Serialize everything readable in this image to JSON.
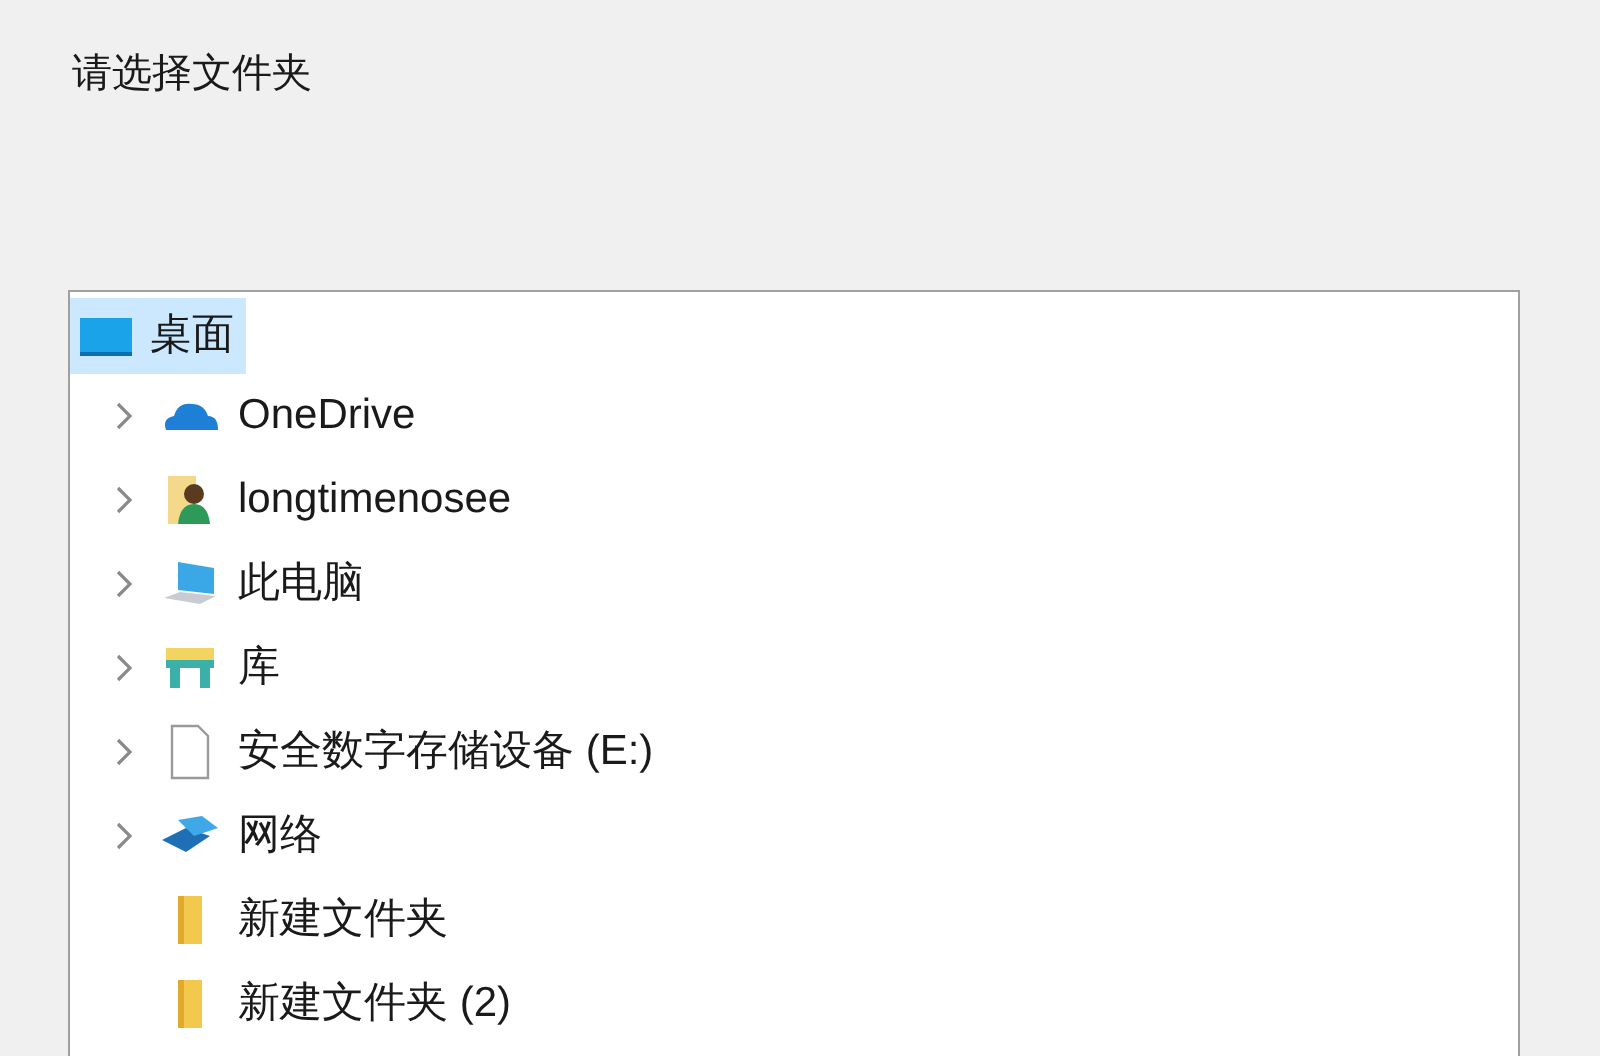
{
  "prompt": "请选择文件夹",
  "tree": {
    "label": "桌面",
    "kind": "desktop",
    "selected": true,
    "children": [
      {
        "label": "OneDrive",
        "kind": "cloud",
        "expandable": true,
        "selected": false
      },
      {
        "label": "longtimenosee",
        "kind": "user",
        "expandable": true,
        "selected": false
      },
      {
        "label": "此电脑",
        "kind": "computer",
        "expandable": true,
        "selected": false
      },
      {
        "label": "库",
        "kind": "library",
        "expandable": true,
        "selected": false
      },
      {
        "label": "安全数字存储设备 (E:)",
        "kind": "drive",
        "expandable": true,
        "selected": false
      },
      {
        "label": "网络",
        "kind": "network",
        "expandable": true,
        "selected": false
      },
      {
        "label": "新建文件夹",
        "kind": "folder",
        "expandable": false,
        "selected": false
      },
      {
        "label": "新建文件夹 (2)",
        "kind": "folder",
        "expandable": false,
        "selected": false
      }
    ]
  }
}
